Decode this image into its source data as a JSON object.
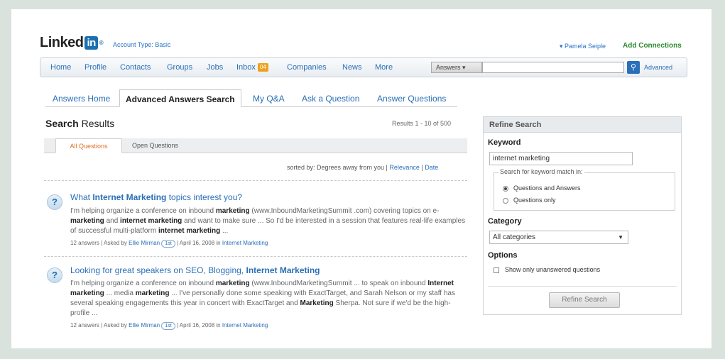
{
  "header": {
    "logo_text": "Linked",
    "logo_in": "in",
    "account_type": "Account Type: Basic",
    "user_name": "▾ Pamela Seiple",
    "add_connections": "Add Connections"
  },
  "nav": {
    "items": [
      "Home",
      "Profile",
      "Contacts",
      "Groups",
      "Jobs"
    ],
    "inbox_label": "Inbox",
    "inbox_badge": "04",
    "items_after": [
      "Companies",
      "News",
      "More"
    ],
    "search_scope": "Answers ▾",
    "search_value": "",
    "advanced": "Advanced"
  },
  "tabs": [
    "Answers Home",
    "Advanced Answers Search",
    "My Q&A",
    "Ask a Question",
    "Answer Questions"
  ],
  "results": {
    "title_bold": "Search",
    "title_rest": " Results",
    "count": "Results 1 - 10 of 500",
    "subtabs": [
      "All Questions",
      "Open Questions"
    ],
    "sorted_prefix": "sorted by: Degrees away from you | ",
    "sort_relevance": "Relevance",
    "sort_sep": " | ",
    "sort_date": "Date"
  },
  "questions": [
    {
      "title_pre": "What ",
      "title_bold": "Internet Marketing",
      "title_post": " topics interest you?",
      "meta_prefix": "12 answers | Asked by ",
      "author": "Ellie Mirman",
      "degree": "1st",
      "meta_suffix": " | April 16, 2008 in ",
      "category": "Internet Marketing"
    },
    {
      "title_pre": "Looking for great speakers on SEO, Blogging, ",
      "title_bold": "Internet Marketing",
      "title_post": "",
      "meta_prefix": "12 answers | Asked by ",
      "author": "Ellie Mirman",
      "degree": "1st",
      "meta_suffix": " | April 16, 2008 in ",
      "category": "Internet Marketing"
    }
  ],
  "refine": {
    "header": "Refine Search",
    "keyword_label": "Keyword",
    "keyword_value": "internet marketing",
    "match_legend": "Search for keyword match in:",
    "match_options": [
      "Questions and Answers",
      "Questions only"
    ],
    "category_label": "Category",
    "category_value": "All categories",
    "options_label": "Options",
    "unanswered_label": "Show only unanswered questions",
    "button": "Refine Search"
  },
  "colors": {
    "link": "#2a6fb8",
    "brand": "#1a6fb0",
    "green": "#2b8a2f",
    "orange": "#e07020"
  }
}
